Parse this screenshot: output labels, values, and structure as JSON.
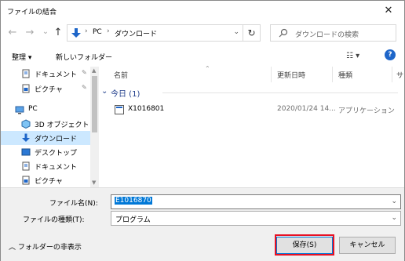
{
  "window": {
    "title": "ファイルの結合",
    "close_glyph": "✕"
  },
  "nav": {
    "back": "←",
    "forward": "→",
    "up": "↑",
    "breadcrumb": [
      "PC",
      "ダウンロード"
    ],
    "refresh": "↻",
    "search_placeholder": "ダウンロードの検索"
  },
  "toolbar": {
    "organize": "整理 ▾",
    "new_folder": "新しいフォルダー",
    "view": "☷ ▾",
    "help": "?"
  },
  "sidebar": {
    "items": [
      {
        "label": "ドキュメント",
        "icon": "document-icon",
        "pinned": true
      },
      {
        "label": "ピクチャ",
        "icon": "pictures-icon",
        "pinned": true
      },
      {
        "label": "PC",
        "icon": "pc-icon",
        "pinned": false
      },
      {
        "label": "3D オブジェクト",
        "icon": "3d-objects-icon",
        "pinned": false
      },
      {
        "label": "ダウンロード",
        "icon": "download-icon",
        "pinned": false,
        "selected": true
      },
      {
        "label": "デスクトップ",
        "icon": "desktop-icon",
        "pinned": false
      },
      {
        "label": "ドキュメント",
        "icon": "document-icon",
        "pinned": false
      },
      {
        "label": "ピクチャ",
        "icon": "pictures-icon",
        "pinned": false
      }
    ],
    "pin_glyph": "📌"
  },
  "list": {
    "columns": [
      "名前",
      "更新日時",
      "種類",
      "サ"
    ],
    "group": "今日 (1)",
    "rows": [
      {
        "name": "X1016801",
        "date": "2020/01/24 14...",
        "type": "アプリケーション"
      }
    ]
  },
  "bottom": {
    "filename_label": "ファイル名(N):",
    "filename_value": "E1016870",
    "filetype_label": "ファイルの種類(T):",
    "filetype_value": "プログラム",
    "toggle_folders": "フォルダーの非表示",
    "save": "保存(S)",
    "cancel": "キャンセル"
  },
  "colors": {
    "accent": "#0078d7",
    "highlight_box": "#e81123",
    "selected_bg": "#cce8ff"
  }
}
